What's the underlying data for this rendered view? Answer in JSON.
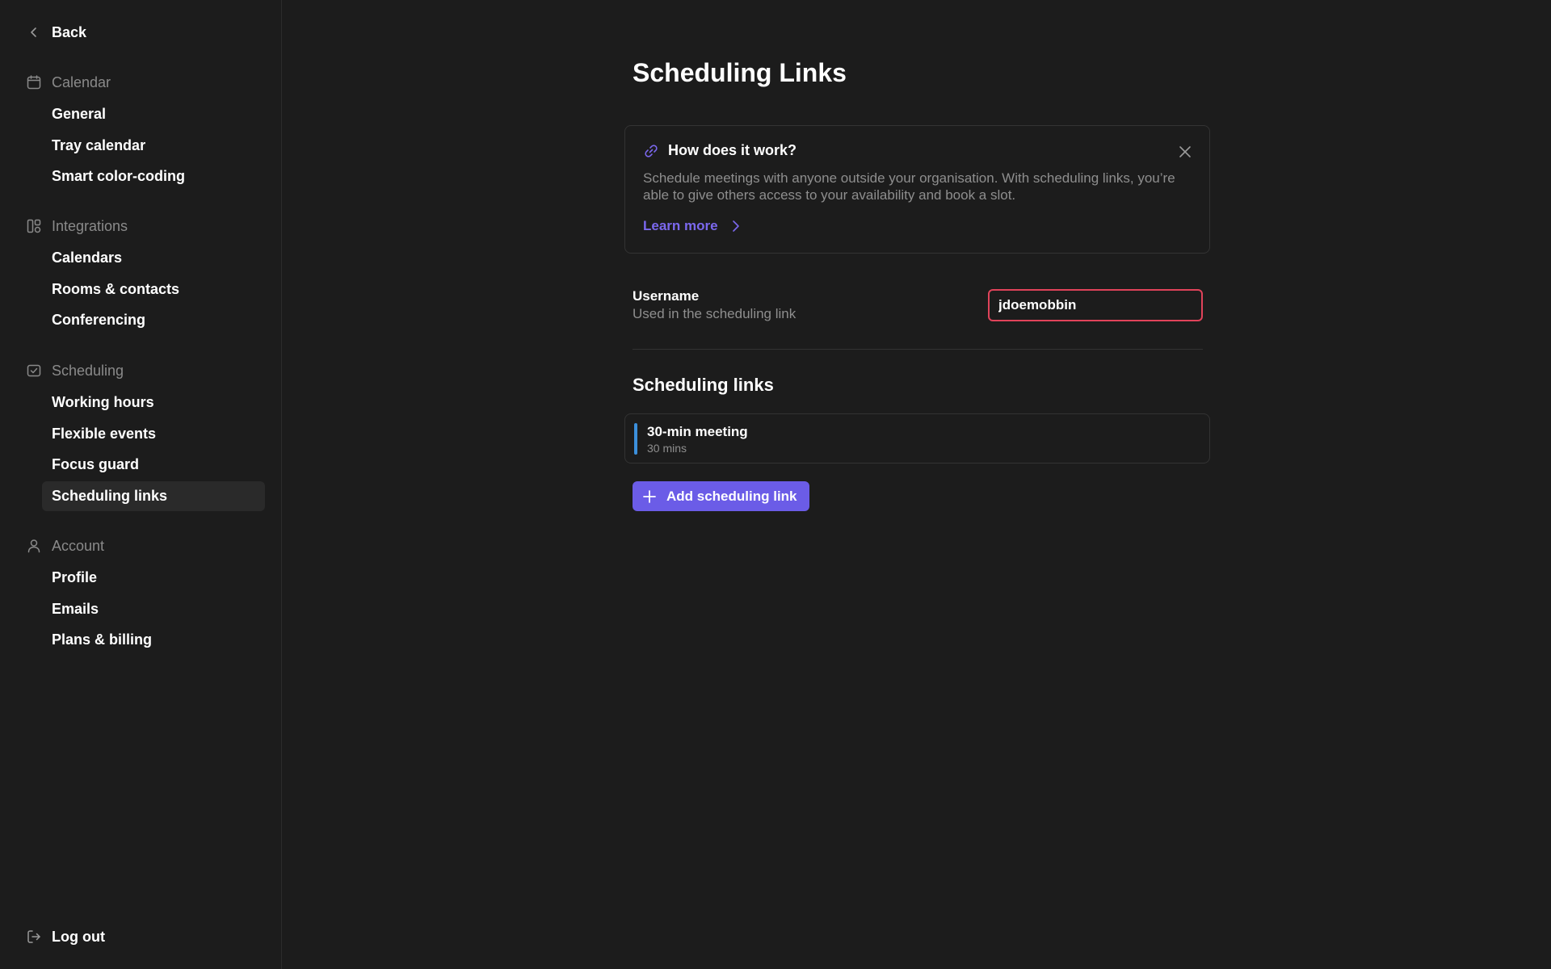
{
  "sidebar": {
    "back_label": "Back",
    "sections": [
      {
        "icon": "calendar-icon",
        "title": "Calendar",
        "items": [
          "General",
          "Tray calendar",
          "Smart color-coding"
        ]
      },
      {
        "icon": "integrations-icon",
        "title": "Integrations",
        "items": [
          "Calendars",
          "Rooms & contacts",
          "Conferencing"
        ]
      },
      {
        "icon": "scheduling-icon",
        "title": "Scheduling",
        "items": [
          "Working hours",
          "Flexible events",
          "Focus guard",
          "Scheduling links"
        ]
      },
      {
        "icon": "account-icon",
        "title": "Account",
        "items": [
          "Profile",
          "Emails",
          "Plans & billing"
        ]
      }
    ],
    "active_item": "Scheduling links",
    "logout_label": "Log out"
  },
  "main": {
    "title": "Scheduling Links",
    "info_card": {
      "icon": "link-icon",
      "title": "How does it work?",
      "description": "Schedule meetings with anyone outside your organisation. With scheduling links, you’re able to give others access to your availability and book a slot.",
      "learn_more_label": "Learn more"
    },
    "username": {
      "label": "Username",
      "help": "Used in the scheduling link",
      "value": "jdoemobbin"
    },
    "links_heading": "Scheduling links",
    "links": [
      {
        "name": "30-min meeting",
        "duration": "30 mins",
        "color": "#3b8fdb"
      }
    ],
    "add_button_label": "Add scheduling link"
  },
  "colors": {
    "background": "#1c1c1c",
    "accent": "#6b5ce7",
    "link_accent": "#7b68ee",
    "error_border": "#e0435a",
    "muted_text": "#8e8e8e"
  }
}
